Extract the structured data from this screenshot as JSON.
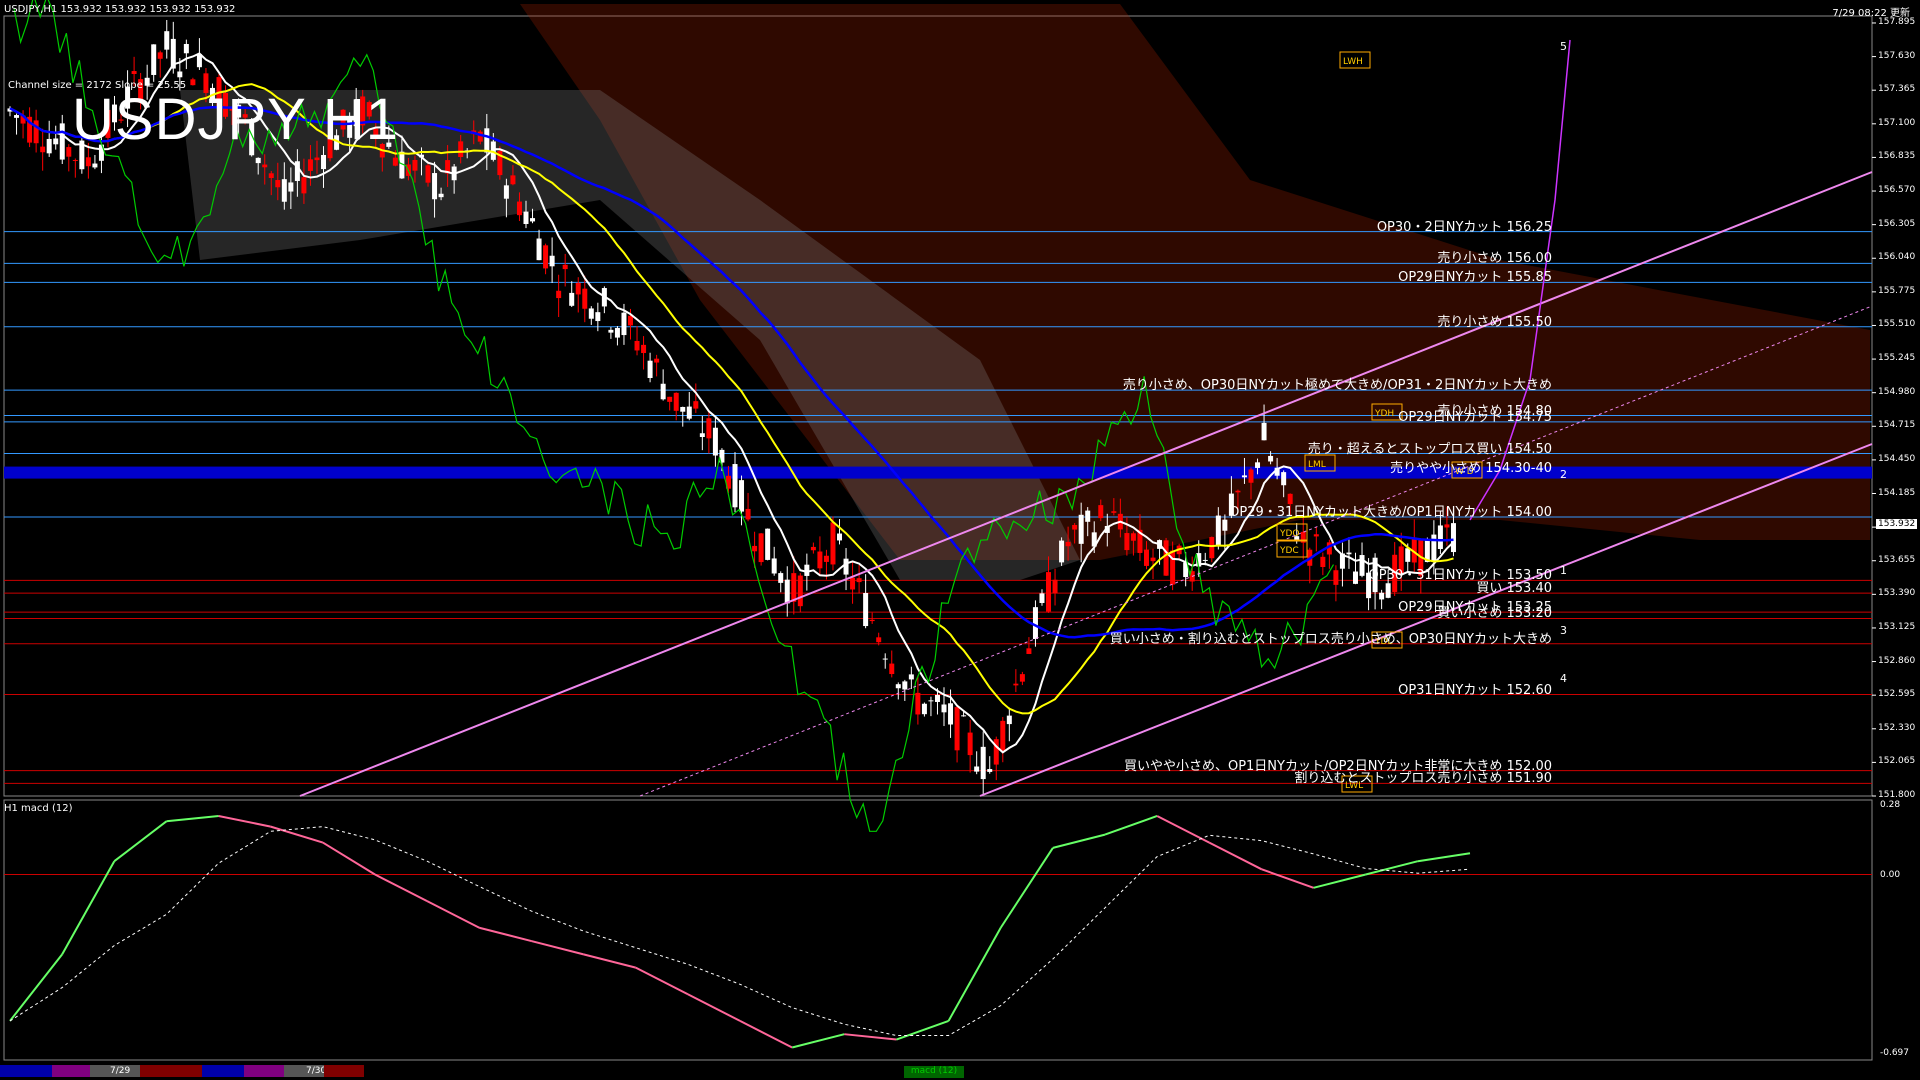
{
  "header": {
    "symbol_info": "USDJPY,H1  153.932 153.932 153.932 153.932",
    "timestamp": "7/29 08:22 更新",
    "big_title": "USDJPY H1",
    "channel_info": "Channel size = 2172 Slope = 25.55"
  },
  "price_axis": {
    "min": 151.8,
    "max": 157.95,
    "ticks": [
      "157.895",
      "157.630",
      "157.365",
      "157.100",
      "156.835",
      "156.570",
      "156.305",
      "156.040",
      "155.775",
      "155.510",
      "155.245",
      "154.980",
      "154.715",
      "154.450",
      "154.185",
      "153.920",
      "153.655",
      "153.390",
      "153.125",
      "152.860",
      "152.595",
      "152.330",
      "152.065",
      "151.800"
    ],
    "current_price": "153.932"
  },
  "macd_axis": {
    "top": "0.28",
    "zero": "0.00",
    "bottom": "-0.697",
    "scale_label": "20000"
  },
  "macd_header": "H1  macd (12)",
  "levels": [
    {
      "price": 156.25,
      "label": "OP30・2日NYカット 156.25",
      "color": "#3399ff"
    },
    {
      "price": 156.0,
      "label": "売り小さめ 156.00",
      "color": "#3399ff"
    },
    {
      "price": 155.85,
      "label": "OP29日NYカット 155.85",
      "color": "#3399ff"
    },
    {
      "price": 155.5,
      "label": "売り小さめ 155.50",
      "color": "#3399ff"
    },
    {
      "price": 155.0,
      "label": "売り小さめ、OP30日NYカット極めて大きめ/OP31・2日NYカット大きめ",
      "color": "#3399ff"
    },
    {
      "price": 154.8,
      "label": "売り小さめ 154.80",
      "color": "#3399ff"
    },
    {
      "price": 154.75,
      "label": "OP29日NYカット 154.75",
      "color": "#3399ff"
    },
    {
      "price": 154.5,
      "label": "売り・超えるとストップロス買い 154.50",
      "color": "#3399ff"
    },
    {
      "price": 154.35,
      "label": "売りやや小さめ 154.30-40",
      "color": "#0000cc"
    },
    {
      "price": 154.0,
      "label": "OP29・31日NYカット大きめ/OP1日NYカット 154.00",
      "color": "#3399ff"
    },
    {
      "price": 153.5,
      "label": "OP30・31日NYカット 153.50",
      "color": "#cc0000"
    },
    {
      "price": 153.4,
      "label": "買い 153.40",
      "color": "#cc0000"
    },
    {
      "price": 153.25,
      "label": "OP29日NYカット 153.25",
      "color": "#cc0000"
    },
    {
      "price": 153.2,
      "label": "買い小さめ 153.20",
      "color": "#cc0000"
    },
    {
      "price": 153.0,
      "label": "買い小さめ・割り込むとストップロス売り小さめ、OP30日NYカット大きめ",
      "color": "#cc0000"
    },
    {
      "price": 152.6,
      "label": "OP31日NYカット 152.60",
      "color": "#cc0000"
    },
    {
      "price": 152.0,
      "label": "買いやや小さめ、OP1日NYカット/OP2日NYカット非常に大きめ 152.00",
      "color": "#cc0000"
    },
    {
      "price": 151.9,
      "label": "割り込むとストップロス売り小さめ 151.90",
      "color": "#cc0000"
    }
  ],
  "box_labels": {
    "lwh": "LWH",
    "ydh": "YDH",
    "lml": "LML",
    "ydo": "YDO",
    "ydc": "YDC",
    "ydl": "YDL",
    "lwl": "LWL",
    "wd": "W D"
  },
  "wave_labels": {
    "w1": "1",
    "w2": "2",
    "w3": "3",
    "w4": "4",
    "w5": "5"
  },
  "dates": {
    "d1": "7/29",
    "d2": "7/30"
  },
  "macd_tab": "macd (12)",
  "chart_data": {
    "type": "candlestick",
    "title": "USDJPY H1",
    "ylim": [
      151.8,
      157.95
    ],
    "close_path": [
      157.2,
      157.0,
      156.8,
      157.3,
      157.7,
      157.5,
      157.1,
      156.5,
      156.9,
      157.2,
      156.8,
      156.6,
      157.0,
      156.5,
      155.9,
      155.7,
      155.4,
      154.9,
      154.6,
      153.9,
      153.4,
      153.8,
      153.2,
      152.6,
      152.4,
      152.0,
      153.0,
      153.8,
      154.0,
      153.7,
      153.6,
      153.9,
      154.6,
      153.8,
      153.6,
      153.5,
      153.7,
      153.9
    ],
    "macd": [
      -0.55,
      -0.3,
      0.05,
      0.2,
      0.22,
      0.18,
      0.12,
      0.0,
      -0.1,
      -0.2,
      -0.25,
      -0.3,
      -0.35,
      -0.45,
      -0.55,
      -0.65,
      -0.6,
      -0.62,
      -0.55,
      -0.2,
      0.1,
      0.15,
      0.22,
      0.12,
      0.02,
      -0.05,
      0.0,
      0.05,
      0.08
    ]
  }
}
